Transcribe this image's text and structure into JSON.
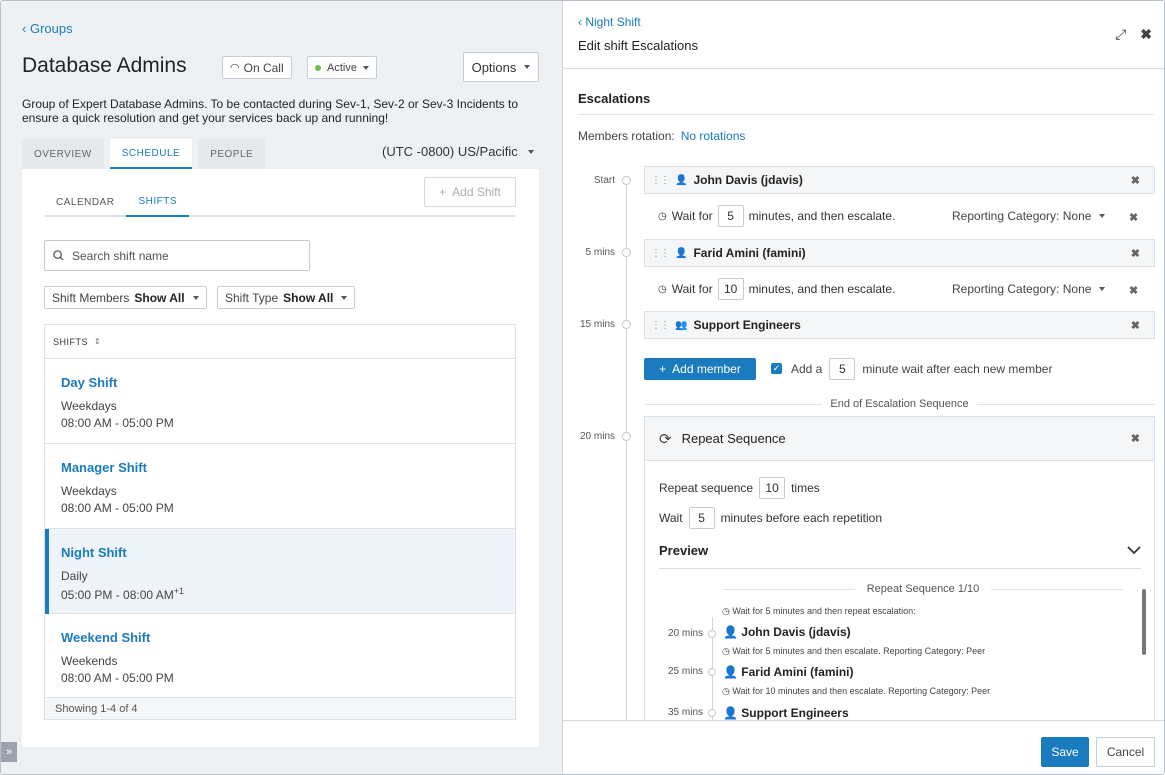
{
  "left": {
    "back_label": "Groups",
    "group_title": "Database Admins",
    "on_call_label": "On Call",
    "status_label": "Active",
    "options_label": "Options",
    "description": "Group of Expert Database Admins. To be contacted during Sev-1, Sev-2 or Sev-3 Incidents to ensure a quick resolution and get your services back up and running!",
    "tabs": [
      "OVERVIEW",
      "SCHEDULE",
      "PEOPLE"
    ],
    "timezone": "(UTC -0800) US/Pacific",
    "subtabs": [
      "CALENDAR",
      "SHIFTS"
    ],
    "add_shift_label": "Add Shift",
    "search_placeholder": "Search shift name",
    "filters": [
      {
        "label": "Shift Members",
        "value": "Show All"
      },
      {
        "label": "Shift Type",
        "value": "Show All"
      }
    ],
    "table_header": "SHIFTS",
    "shifts": [
      {
        "name": "Day Shift",
        "days": "Weekdays",
        "time": "08:00 AM - 05:00 PM",
        "sup": ""
      },
      {
        "name": "Manager Shift",
        "days": "Weekdays",
        "time": "08:00 AM - 05:00 PM",
        "sup": ""
      },
      {
        "name": "Night Shift",
        "days": "Daily",
        "time": "05:00 PM - 08:00 AM",
        "sup": "+1"
      },
      {
        "name": "Weekend Shift",
        "days": "Weekends",
        "time": "08:00 AM - 05:00 PM",
        "sup": ""
      }
    ],
    "showing": "Showing 1-4 of 4"
  },
  "right": {
    "back_label": "Night Shift",
    "title": "Edit shift Escalations",
    "section_title": "Escalations",
    "rotation_label": "Members rotation:",
    "rotation_value": "No rotations",
    "timeline_labels": [
      "Start",
      "5 mins",
      "15 mins",
      "20 mins"
    ],
    "members": [
      {
        "name": "John Davis (jdavis)",
        "icon": "user-icon"
      },
      {
        "name": "Farid Amini (famini)",
        "icon": "user-icon"
      },
      {
        "name": "Support Engineers",
        "icon": "group-icon"
      }
    ],
    "waits": [
      {
        "prefix": "Wait for",
        "value": "5",
        "suffix": "minutes, and then escalate.",
        "category": "Reporting Category: None"
      },
      {
        "prefix": "Wait for",
        "value": "10",
        "suffix": "minutes, and then escalate.",
        "category": "Reporting Category: None"
      }
    ],
    "add_member_label": "Add member",
    "add_wait": {
      "prefix": "Add a",
      "value": "5",
      "suffix": "minute wait after each new member"
    },
    "end_sequence": "End of Escalation Sequence",
    "repeat": {
      "title": "Repeat Sequence",
      "times_prefix": "Repeat sequence",
      "times_value": "10",
      "times_suffix": "times",
      "wait_prefix": "Wait",
      "wait_value": "5",
      "wait_suffix": "minutes before each repetition",
      "preview_label": "Preview",
      "seq_label": "Repeat Sequence 1/10",
      "preview_wait": "Wait for 5 minutes and then repeat escalation:",
      "preview_items": [
        {
          "time": "20 mins",
          "name": "John Davis (jdavis)",
          "after": "Wait for 5 minutes and then escalate. Reporting Category: Peer"
        },
        {
          "time": "25 mins",
          "name": "Farid Amini (famini)",
          "after": "Wait for 10 minutes and then escalate. Reporting Category: Peer"
        },
        {
          "time": "35 mins",
          "name": "Support Engineers",
          "after": ""
        }
      ]
    },
    "save_label": "Save",
    "cancel_label": "Cancel"
  },
  "colors": {
    "accent": "#1a7bbf",
    "active_dot": "#6cc04a"
  }
}
